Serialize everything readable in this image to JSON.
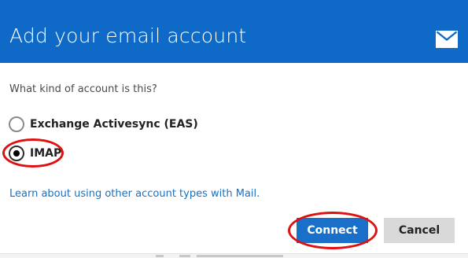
{
  "dialog": {
    "title": "Add your email account",
    "header_color": "#0e6ac6",
    "header_icon": "envelope-icon"
  },
  "form": {
    "question": "What kind of account is this?",
    "options": [
      {
        "label": "Exchange Activesync (EAS)",
        "selected": false
      },
      {
        "label": "IMAP",
        "selected": true
      }
    ]
  },
  "link": {
    "text": "Learn about using other account types with Mail."
  },
  "buttons": {
    "connect_label": "Connect",
    "cancel_label": "Cancel"
  },
  "colors": {
    "accent": "#1a70c9",
    "link": "#1a6fc0",
    "annotation": "#e01010"
  }
}
